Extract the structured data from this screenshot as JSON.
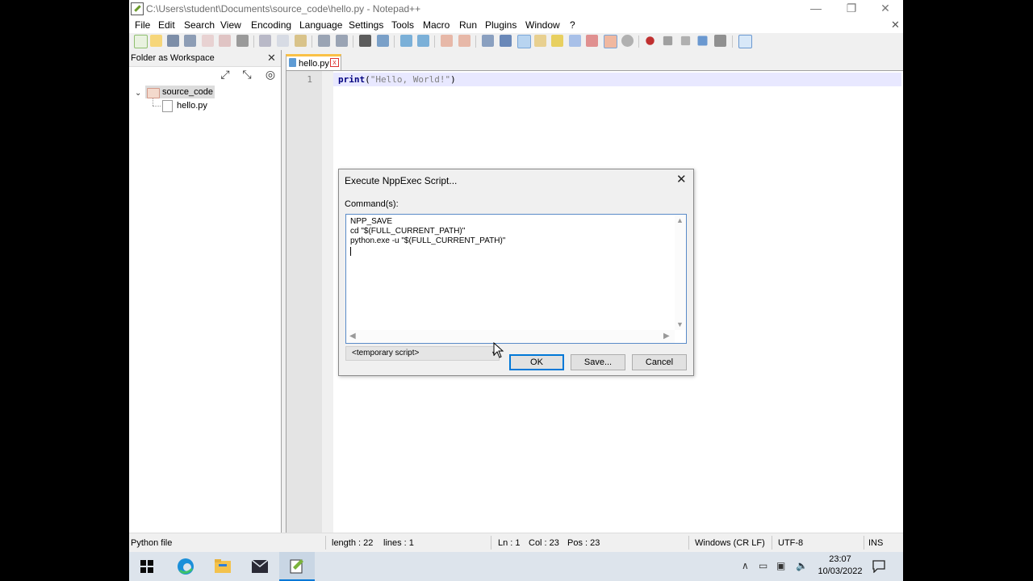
{
  "window": {
    "title": "C:\\Users\\student\\Documents\\source_code\\hello.py - Notepad++",
    "minimize_glyph": "—",
    "restore_glyph": "❐",
    "close_glyph": "✕"
  },
  "menu": {
    "items": [
      "File",
      "Edit",
      "Search",
      "View",
      "Encoding",
      "Language",
      "Settings",
      "Tools",
      "Macro",
      "Run",
      "Plugins",
      "Window",
      "?"
    ],
    "close_glyph": "✕"
  },
  "panel": {
    "title": "Folder as Workspace",
    "close_glyph": "✕",
    "folder": "source_code",
    "file": "hello.py",
    "expand_glyph": "⌄"
  },
  "editor": {
    "tab_label": "hello.py",
    "tab_close_glyph": "x",
    "line_number": "1",
    "code_keyword": "print",
    "code_open": "(",
    "code_string": "\"Hello, World!\"",
    "code_close": ")"
  },
  "status": {
    "file_type": "Python file",
    "length": "length : 22",
    "lines": "lines : 1",
    "ln": "Ln : 1",
    "col": "Col : 23",
    "pos": "Pos : 23",
    "eol": "Windows (CR LF)",
    "encoding": "UTF-8",
    "mode": "INS"
  },
  "dialog": {
    "title": "Execute NppExec Script...",
    "close_glyph": "✕",
    "commands_label": "Command(s):",
    "commands": [
      "NPP_SAVE",
      "cd \"$(FULL_CURRENT_PATH)\"",
      "python.exe -u \"$(FULL_CURRENT_PATH)\""
    ],
    "script_name": "<temporary script>",
    "ok_label": "OK",
    "save_label": "Save...",
    "cancel_label": "Cancel"
  },
  "taskbar": {
    "time": "23:07",
    "date": "10/03/2022"
  },
  "colors": {
    "accent": "#0078d7",
    "tab_highlight": "#fac146",
    "current_line": "#e8e8ff"
  }
}
